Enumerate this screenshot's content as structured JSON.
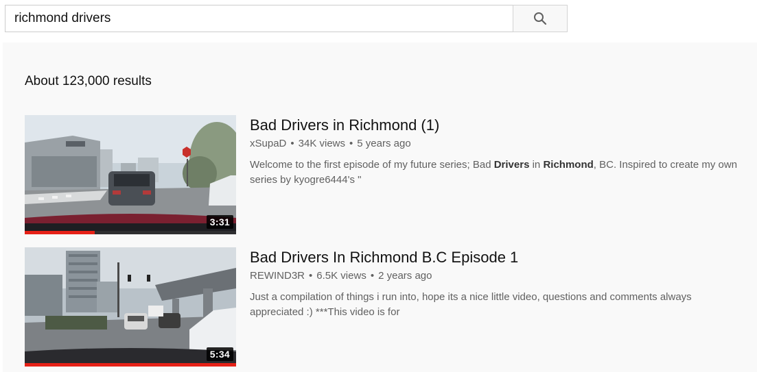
{
  "search": {
    "query": "richmond drivers",
    "button_icon": "search-icon"
  },
  "results_summary": "About 123,000 results",
  "results": [
    {
      "title": "Bad Drivers in Richmond (1)",
      "channel": "xSupaD",
      "views": "34K views",
      "age": "5 years ago",
      "duration": "3:31",
      "watched_fraction": 0.33,
      "description_parts": [
        {
          "text": "Welcome to the first episode of my future series; Bad ",
          "bold": false
        },
        {
          "text": "Drivers",
          "bold": true
        },
        {
          "text": " in ",
          "bold": false
        },
        {
          "text": "Richmond",
          "bold": true
        },
        {
          "text": ", BC. Inspired to create my own series by kyogre6444's \"",
          "bold": false
        }
      ]
    },
    {
      "title": "Bad Drivers In Richmond B.C Episode 1",
      "channel": "REWIND3R",
      "views": "6.5K views",
      "age": "2 years ago",
      "duration": "5:34",
      "watched_fraction": 1.0,
      "description_parts": [
        {
          "text": "Just a compilation of things i run into, hope its a nice little video, questions and comments always appreciated :) ***This video is for",
          "bold": false
        }
      ]
    }
  ],
  "colors": {
    "accent_red": "#e62117",
    "page_bg": "#f9f9f9"
  }
}
